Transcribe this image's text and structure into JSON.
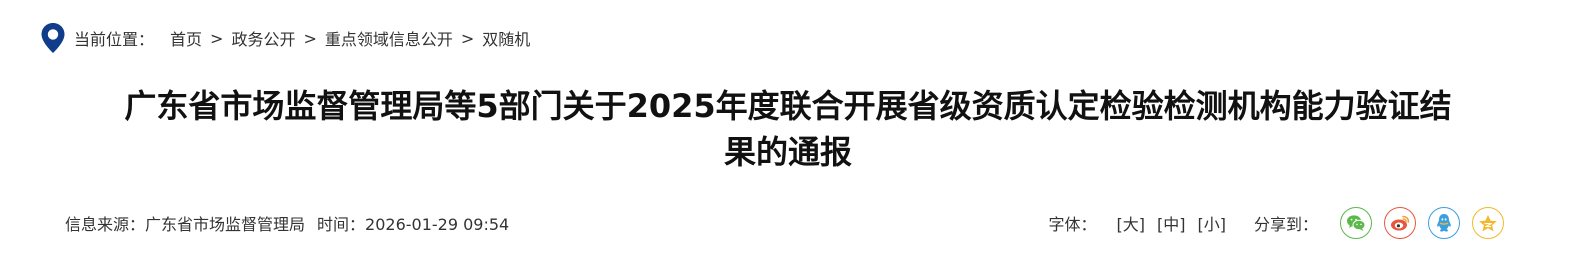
{
  "breadcrumb": {
    "label": "当前位置：",
    "items": [
      "首页",
      "政务公开",
      "重点领域信息公开",
      "双随机"
    ],
    "separator": ">"
  },
  "article": {
    "title_line1": "广东省市场监督管理局等5部门关于2025年度联合开展省级资质认定检验检测机构能力验证结",
    "title_line2": "果的通报"
  },
  "meta": {
    "source_label": "信息来源：",
    "source_value": "广东省市场监督管理局",
    "time_label": "时间：",
    "time_value": "2026-01-29 09:54"
  },
  "font_size": {
    "label": "字体：",
    "large": "[大]",
    "medium": "[中]",
    "small": "[小]"
  },
  "share": {
    "label": "分享到：",
    "targets": [
      {
        "name": "wechat",
        "icon": "wechat-icon",
        "color": "#5ab947"
      },
      {
        "name": "weibo",
        "icon": "weibo-icon",
        "color": "#e8573c"
      },
      {
        "name": "qq",
        "icon": "qq-icon",
        "color": "#3a9fe0"
      },
      {
        "name": "qzone",
        "icon": "qzone-star-icon",
        "color": "#f2b92c"
      }
    ]
  },
  "colors": {
    "pin": "#0f3d8a",
    "text": "#333333",
    "title": "#111111"
  }
}
